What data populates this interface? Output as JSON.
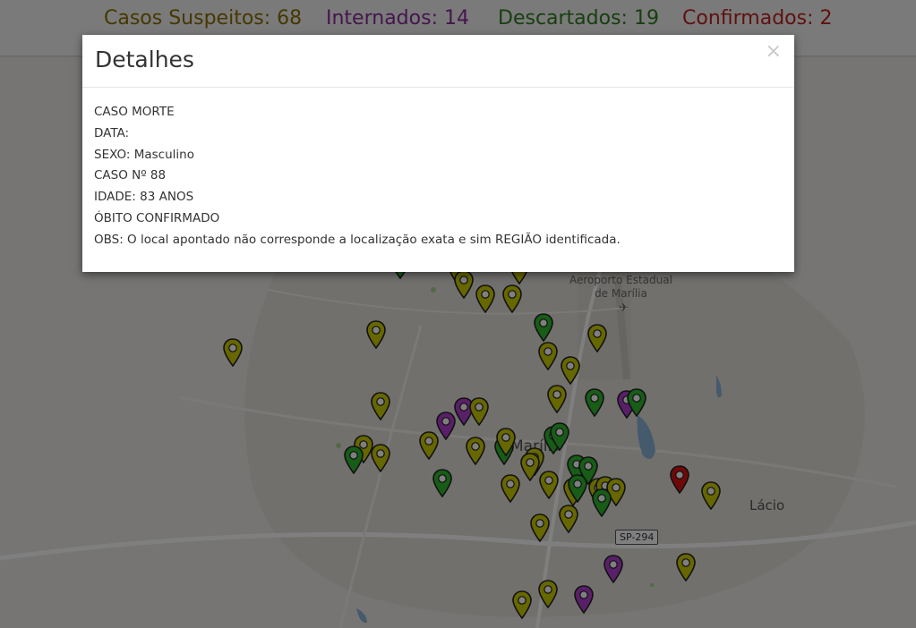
{
  "stats": {
    "suspeitos": {
      "text": "Casos Suspeitos: 68",
      "color": "#8a7000"
    },
    "internados": {
      "text": "Internados: 14",
      "color": "#8a2c9c"
    },
    "descartados": {
      "text": "Descartados: 19",
      "color": "#2f7f1f"
    },
    "confirmados": {
      "text": "Confirmados: 2",
      "color": "#c0221f"
    }
  },
  "map": {
    "labels": {
      "airport": "Aeroporto Estadual\nde Marília",
      "city": "Marília",
      "lacio": "Lácio",
      "road": "SP-294"
    },
    "marker_colors": {
      "suspeito": "#cfcf00",
      "descartado": "#2eb82e",
      "internado": "#b33fd1",
      "confirmado": "#e01010"
    }
  },
  "modal": {
    "title": "Detalhes",
    "close_label": "×",
    "lines": [
      "CASO MORTE",
      "DATA:",
      "SEXO: Masculino",
      "CASO Nº 88",
      "IDADE: 83 ANOS",
      "ÓBITO CONFIRMADO",
      "OBS: O local apontado não corresponde a localização exata e sim REGIÃO identificada."
    ]
  }
}
